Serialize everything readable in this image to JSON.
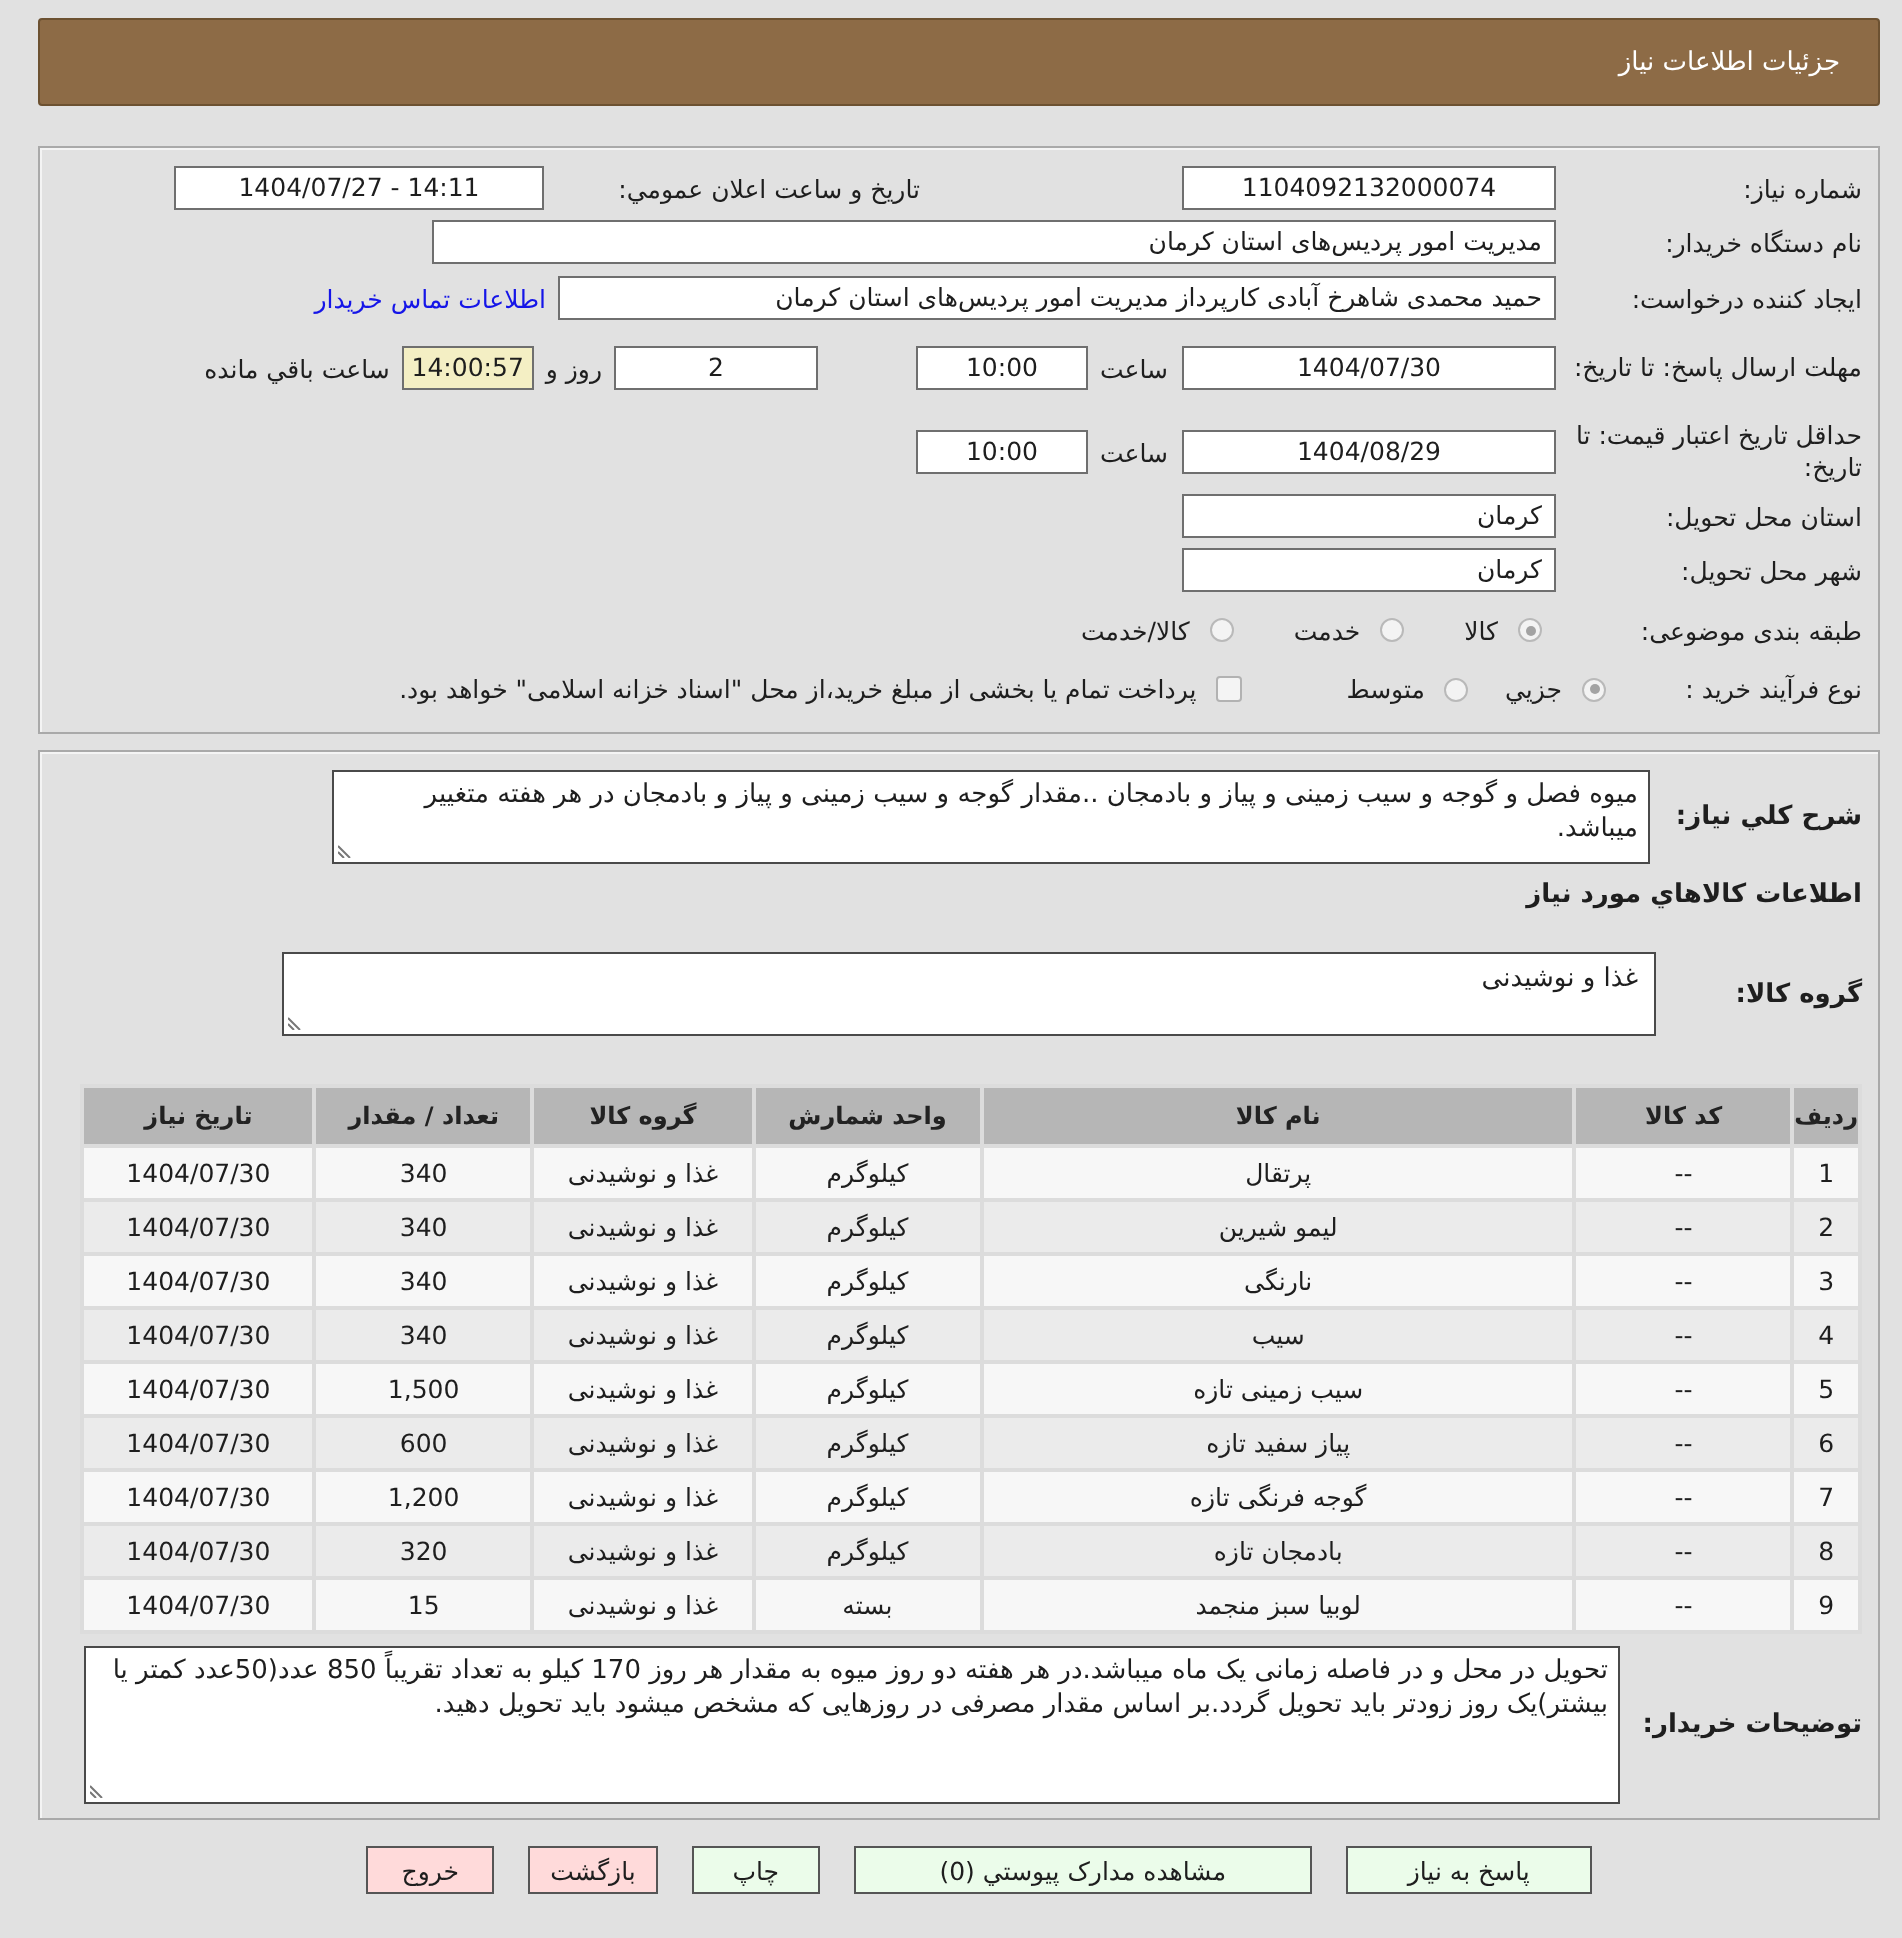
{
  "header": {
    "title": "جزئیات اطلاعات نیاز"
  },
  "details": {
    "need_number": {
      "label": "شماره نیاز:",
      "value": "1104092132000074"
    },
    "announcement": {
      "label": "تاریخ و ساعت اعلان عمومي:",
      "value": "1404/07/27 - 14:11"
    },
    "buyer_org": {
      "label": "نام دستگاه خریدار:",
      "value": "مدیریت امور پردیس‌های استان کرمان"
    },
    "requester": {
      "label": "ایجاد کننده درخواست:",
      "value": "حمید محمدی شاهرخ آبادی کارپرداز مدیریت امور پردیس‌های استان کرمان",
      "contact_link": "اطلاعات تماس خریدار"
    },
    "reply_deadline": {
      "label": "مهلت ارسال پاسخ: تا تاریخ:",
      "date": "1404/07/30",
      "time_label": "ساعت",
      "time": "10:00",
      "days": "2",
      "days_label": "روز و",
      "remaining": "14:00:57",
      "remaining_label": "ساعت باقي مانده"
    },
    "price_validity": {
      "label": "حداقل تاریخ اعتبار قیمت: تا تاریخ:",
      "date": "1404/08/29",
      "time_label": "ساعت",
      "time": "10:00"
    },
    "delivery_province": {
      "label": "استان محل تحویل:",
      "value": "کرمان"
    },
    "delivery_city": {
      "label": "شهر محل تحویل:",
      "value": "کرمان"
    },
    "subject_category": {
      "label": "طبقه بندی موضوعی:",
      "options": [
        {
          "label": "کالا",
          "selected": true
        },
        {
          "label": "خدمت",
          "selected": false
        },
        {
          "label": "کالا/خدمت",
          "selected": false
        }
      ]
    },
    "purchase_process": {
      "label": "نوع فرآیند خرید :",
      "options": [
        {
          "label": "جزيي",
          "selected": true
        },
        {
          "label": "متوسط",
          "selected": false
        }
      ],
      "treasury_payment": {
        "label": "پرداخت تمام يا بخشی از مبلغ خرید،از محل \"اسناد خزانه اسلامی\" خواهد بود.",
        "checked": false
      }
    }
  },
  "goods": {
    "description": {
      "label": "شرح کلي نياز:",
      "value": "میوه فصل و گوجه و سیب زمینی و پیاز و بادمجان ..مقدار گوجه و سیب زمینی و پیاز و بادمجان در هر هفته متغییر میباشد."
    },
    "section_title": "اطلاعات کالاهاي مورد نياز",
    "goods_group": {
      "label": "گروه کالا:",
      "value": "غذا و نوشیدنی"
    },
    "table": {
      "columns": [
        "ردیف",
        "کد کالا",
        "نام کالا",
        "واحد شمارش",
        "گروه کالا",
        "تعداد / مقدار",
        "تاریخ نیاز"
      ],
      "rows": [
        [
          "1",
          "--",
          "پرتقال",
          "کیلوگرم",
          "غذا و نوشیدنی",
          "340",
          "1404/07/30"
        ],
        [
          "2",
          "--",
          "لیمو شیرین",
          "کیلوگرم",
          "غذا و نوشیدنی",
          "340",
          "1404/07/30"
        ],
        [
          "3",
          "--",
          "نارنگی",
          "کیلوگرم",
          "غذا و نوشیدنی",
          "340",
          "1404/07/30"
        ],
        [
          "4",
          "--",
          "سیب",
          "کیلوگرم",
          "غذا و نوشیدنی",
          "340",
          "1404/07/30"
        ],
        [
          "5",
          "--",
          "سیب زمینی تازه",
          "کیلوگرم",
          "غذا و نوشیدنی",
          "1,500",
          "1404/07/30"
        ],
        [
          "6",
          "--",
          "پیاز سفید تازه",
          "کیلوگرم",
          "غذا و نوشیدنی",
          "600",
          "1404/07/30"
        ],
        [
          "7",
          "--",
          "گوجه فرنگی تازه",
          "کیلوگرم",
          "غذا و نوشیدنی",
          "1,200",
          "1404/07/30"
        ],
        [
          "8",
          "--",
          "بادمجان تازه",
          "کیلوگرم",
          "غذا و نوشیدنی",
          "320",
          "1404/07/30"
        ],
        [
          "9",
          "--",
          "لوبیا سبز منجمد",
          "بسته",
          "غذا و نوشیدنی",
          "15",
          "1404/07/30"
        ]
      ]
    },
    "buyer_notes": {
      "label": "توضیحات خریدار:",
      "value": "تحویل در محل و در فاصله زمانی یک ماه میباشد.در هر هفته دو روز میوه به مقدار هر روز 170 کیلو به تعداد تقریباً 850 عدد(50عدد کمتر یا بیشتر)یک روز زودتر باید تحویل گردد.بر اساس مقدار مصرفی در روزهایی که مشخص میشود باید تحویل دهید."
    }
  },
  "buttons": [
    {
      "label": "پاسخ به نياز",
      "kind": "positive"
    },
    {
      "label": "مشاهده مدارک پیوستي (0)",
      "kind": "positive"
    },
    {
      "label": "چاپ",
      "kind": "positive"
    },
    {
      "label": "بازگشت",
      "kind": "negative"
    },
    {
      "label": "خروج",
      "kind": "negative"
    }
  ]
}
